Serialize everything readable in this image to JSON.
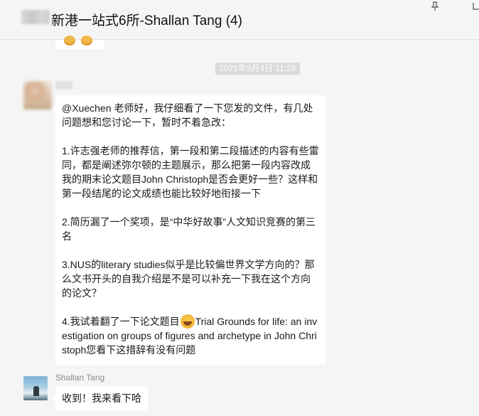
{
  "chat": {
    "title": "新港一站式6所-Shallan Tang (4)"
  },
  "messages": {
    "timestamp": "2021年9月4日 11:28",
    "long_message": {
      "p1": "@Xuechen 老师好，我仔细看了一下您发的文件，有几处问题想和您讨论一下，暂时不着急改：",
      "p2": "1.许志强老师的推荐信，第一段和第二段描述的内容有些雷同，都是阐述弥尔顿的主题展示，那么把第一段内容改成我的期末论文题目John Christoph是否会更好一些？这样和第一段结尾的论文成绩也能比较好地衔接一下",
      "p3": "2.简历漏了一个奖项，是“中华好故事”人文知识竞赛的第三名",
      "p4": "3.NUS的literary studies似乎是比较偏世界文学方向的？那么文书开头的自我介绍是不是可以补充一下我在这个方向的论文？",
      "p5_before": "4.我试着翻了一下论文题目",
      "p5_after": "Trial Grounds for life: an investigation on groups of figures and archetype in John Christoph您看下这措辞有没有问题"
    },
    "reply": {
      "sender": "Shallan Tang",
      "text": "收到！我来看下哈"
    }
  },
  "icons": {
    "pin": "pin-icon",
    "more": "more-icon",
    "emoji": "grinning-sweat-emoji-icon"
  },
  "colors": {
    "background": "#f5f5f5",
    "bubble": "#ffffff",
    "timestamp_bg": "#dadada"
  }
}
